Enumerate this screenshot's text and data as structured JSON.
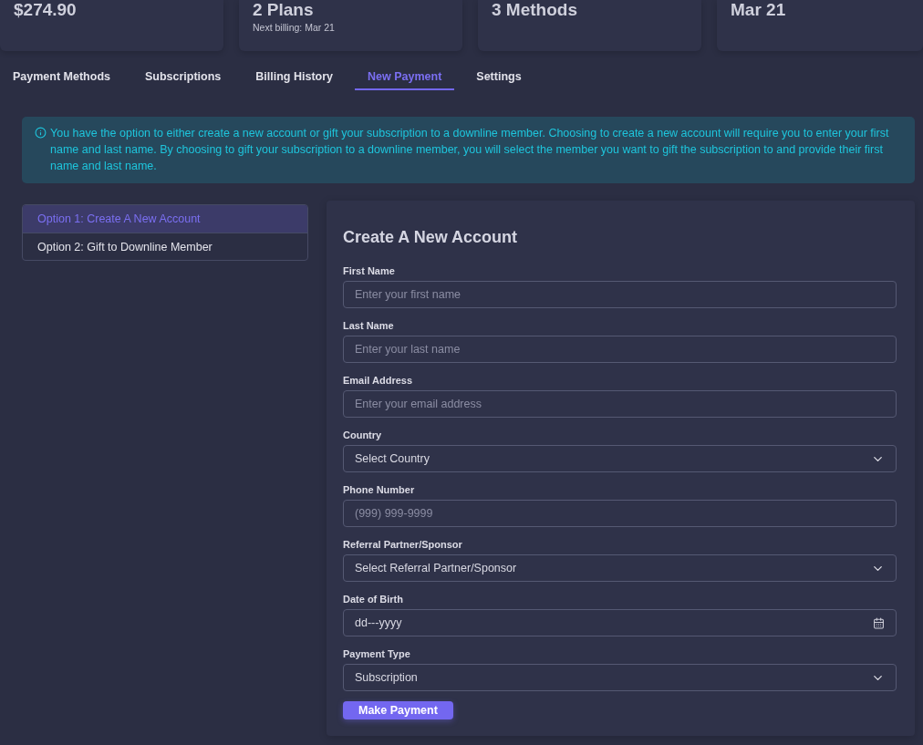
{
  "stat_cards": [
    {
      "value": "$274.90"
    },
    {
      "value": "2 Plans",
      "note": "Next billing: Mar 21"
    },
    {
      "value": "3 Methods"
    },
    {
      "value": "Mar 21"
    }
  ],
  "tabs": [
    {
      "label": "Payment Methods",
      "selected": false
    },
    {
      "label": "Subscriptions",
      "selected": false
    },
    {
      "label": "Billing History",
      "selected": false
    },
    {
      "label": "New Payment",
      "selected": true
    },
    {
      "label": "Settings",
      "selected": false
    }
  ],
  "alert": {
    "text": "You have the option to either create a new account or gift your subscription to a downline member. Choosing to create a new account will require you to enter your first name and last name. By choosing to gift your subscription to a downline member, you will select the member you want to gift the subscription to and provide their first name and last name."
  },
  "options": [
    {
      "label": "Option 1: Create A New Account",
      "selected": true
    },
    {
      "label": "Option 2: Gift to Downline Member",
      "selected": false
    }
  ],
  "form": {
    "title": "Create A New Account",
    "fields": [
      {
        "kind": "text",
        "label": "First Name",
        "placeholder": "Enter your first name"
      },
      {
        "kind": "text",
        "label": "Last Name",
        "placeholder": "Enter your last name"
      },
      {
        "kind": "text",
        "label": "Email Address",
        "placeholder": "Enter your email address"
      },
      {
        "kind": "select",
        "label": "Country",
        "value": "Select Country"
      },
      {
        "kind": "text",
        "label": "Phone Number",
        "placeholder": "(999) 999-9999"
      },
      {
        "kind": "select",
        "label": "Referral Partner/Sponsor",
        "value": "Select Referral Partner/Sponsor"
      },
      {
        "kind": "date",
        "label": "Date of Birth",
        "value": "dd---yyyy"
      },
      {
        "kind": "select",
        "label": "Payment Type",
        "value": "Subscription"
      }
    ],
    "submit": "Make Payment"
  }
}
